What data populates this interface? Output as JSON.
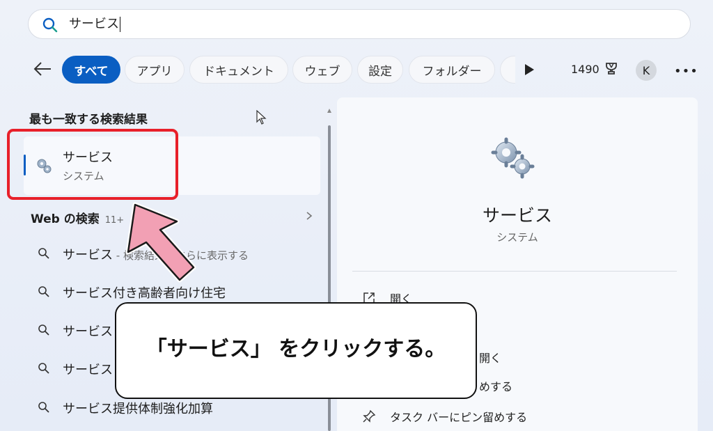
{
  "search": {
    "query": "サービス"
  },
  "tabs": [
    {
      "label": "すべて",
      "active": true
    },
    {
      "label": "アプリ"
    },
    {
      "label": "ドキュメント"
    },
    {
      "label": "ウェブ"
    },
    {
      "label": "設定"
    },
    {
      "label": "フォルダー"
    },
    {
      "label": ""
    }
  ],
  "header": {
    "points": "1490",
    "avatar_initial": "K"
  },
  "best_match": {
    "section_title": "最も一致する検索結果",
    "title": "サービス",
    "subtitle": "システム"
  },
  "web_search": {
    "title": "Web の検索",
    "count": "11+",
    "items": [
      {
        "text": "サービス",
        "hint": " - 検索結果をさらに表示する"
      },
      {
        "text": "サービス付き高齢者向け住宅",
        "hint": ""
      },
      {
        "text": "サービス",
        "hint": ""
      },
      {
        "text": "サービス",
        "hint": ""
      },
      {
        "text": "サービス提供体制強化加算",
        "hint": ""
      }
    ]
  },
  "details": {
    "title": "サービス",
    "subtitle": "システム",
    "actions": [
      {
        "label": "開く",
        "icon": "open-icon"
      },
      {
        "label": "開く",
        "icon": ""
      },
      {
        "label": "めする",
        "icon": ""
      },
      {
        "label": "タスク バーにピン留めする",
        "icon": "pin-icon"
      }
    ]
  },
  "callout": {
    "text": "「サービス」 をクリックする。"
  },
  "colors": {
    "accent": "#0a5ec2",
    "highlight": "#e8202a",
    "arrow": "#f2a0b4"
  }
}
